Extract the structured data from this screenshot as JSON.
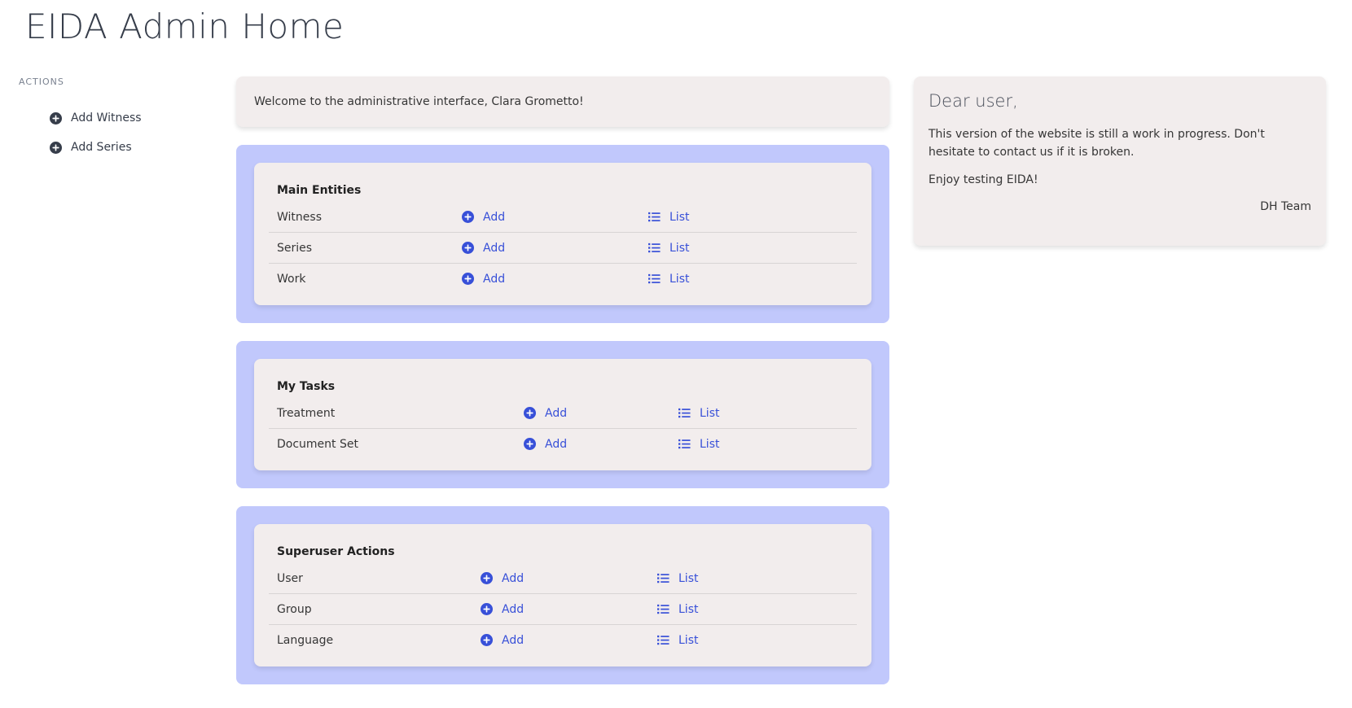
{
  "page": {
    "title": "EIDA Admin Home"
  },
  "sidebar": {
    "label": "ACTIONS",
    "items": [
      {
        "label": "Add Witness",
        "icon": "plus-circle-icon"
      },
      {
        "label": "Add Series",
        "icon": "plus-circle-icon"
      }
    ]
  },
  "welcome": {
    "text": "Welcome to the administrative interface, Clara Grometto!"
  },
  "sections": [
    {
      "title": "Main Entities",
      "rows": [
        {
          "name": "Witness",
          "add": "Add",
          "list": "List"
        },
        {
          "name": "Series",
          "add": "Add",
          "list": "List"
        },
        {
          "name": "Work",
          "add": "Add",
          "list": "List"
        }
      ]
    },
    {
      "title": "My Tasks",
      "rows": [
        {
          "name": "Treatment",
          "add": "Add",
          "list": "List"
        },
        {
          "name": "Document Set",
          "add": "Add",
          "list": "List"
        }
      ]
    },
    {
      "title": "Superuser Actions",
      "rows": [
        {
          "name": "User",
          "add": "Add",
          "list": "List"
        },
        {
          "name": "Group",
          "add": "Add",
          "list": "List"
        },
        {
          "name": "Language",
          "add": "Add",
          "list": "List"
        }
      ]
    }
  ],
  "notice": {
    "title": "Dear user,",
    "paragraph1": "This version of the website is still a work in progress. Don't hesitate to contact us if it is broken.",
    "paragraph2": "Enjoy testing EIDA!",
    "signature": "DH Team"
  },
  "colors": {
    "panel_bg": "#c1c8fc",
    "card_bg": "#f2eded",
    "link": "#3850d8",
    "sidebar_icon": "#363d4a"
  }
}
